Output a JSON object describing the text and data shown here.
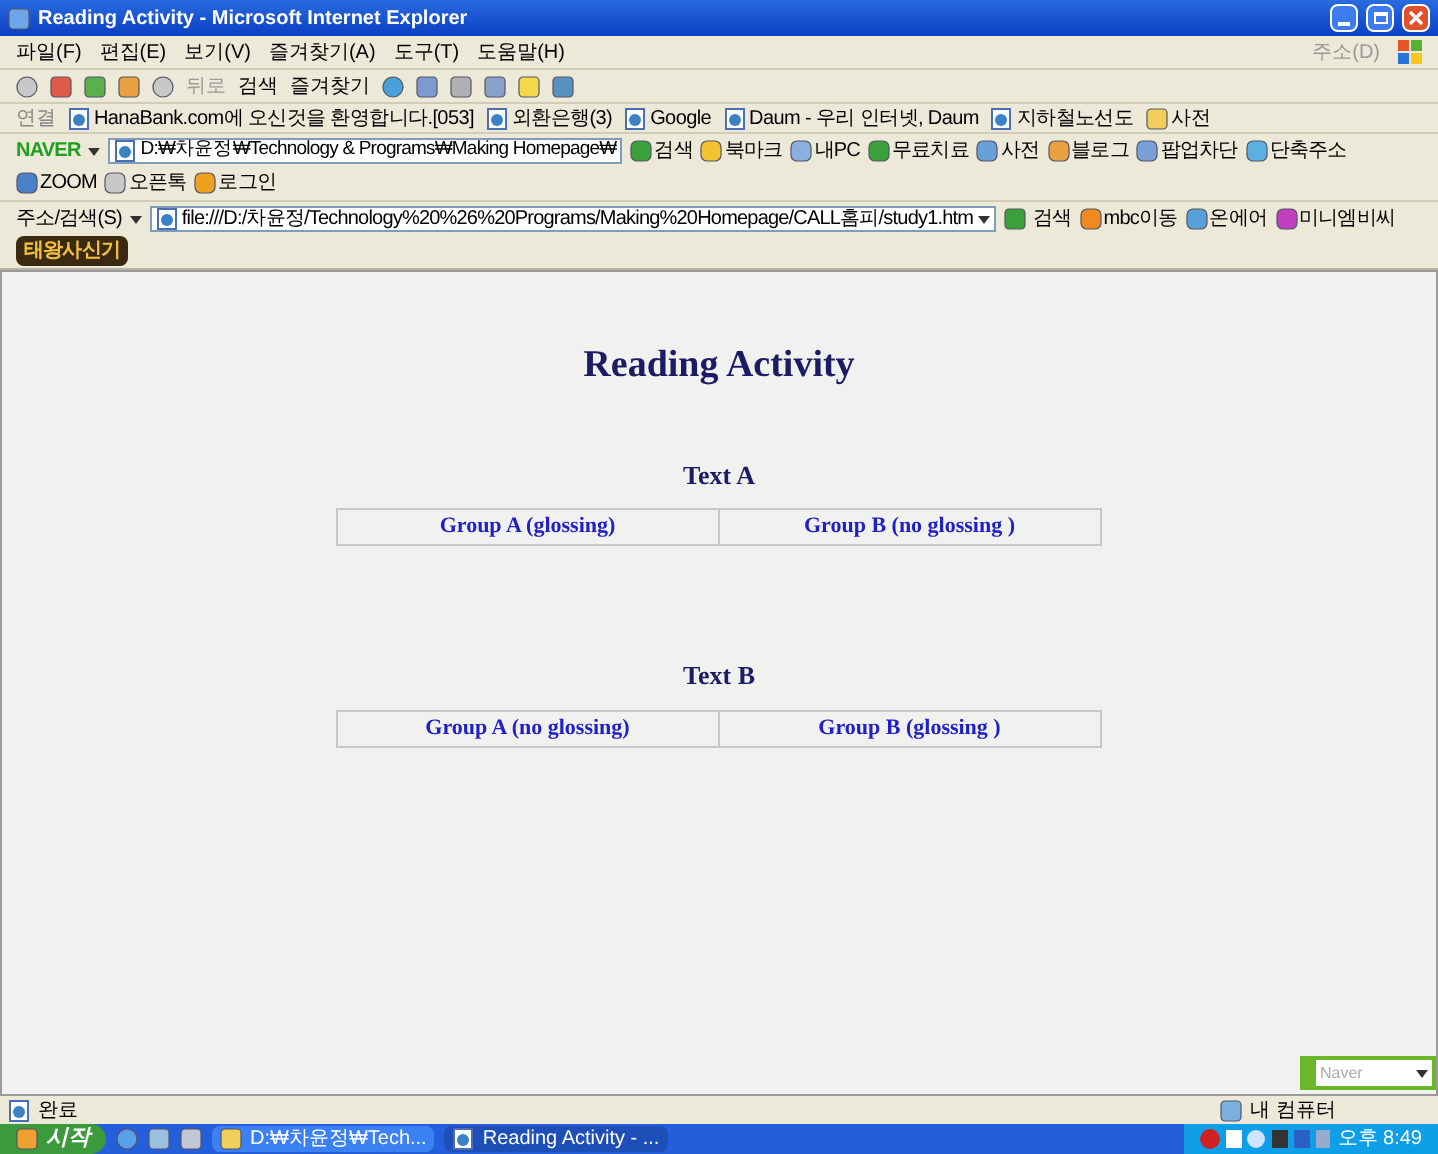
{
  "window": {
    "title": "Reading Activity - Microsoft Internet Explorer"
  },
  "menu_bar": {
    "items": [
      "파일(F)",
      "편집(E)",
      "보기(V)",
      "즐겨찾기(A)",
      "도구(T)",
      "도움말(H)"
    ],
    "address_label": "주소(D)"
  },
  "toolbar": {
    "buttons": [
      {
        "label": "뒤로",
        "disabled": true
      },
      {
        "label": "검색",
        "disabled": false
      },
      {
        "label": "즐겨찾기",
        "disabled": false
      }
    ]
  },
  "links_bar": {
    "label": "연결",
    "links": [
      "HanaBank.com에 오신것을 환영합니다.[053]",
      "외환은행(3)",
      "Google",
      "Daum - 우리 인터넷, Daum",
      "지하철노선도",
      "사전"
    ]
  },
  "naver_bar": {
    "logo": "NAVER",
    "path": "D:₩차윤정₩Technology & Programs₩Making Homepage₩",
    "items": [
      "검색",
      "북마크",
      "내PC",
      "무료치료",
      "사전",
      "블로그",
      "팝업차단",
      "단축주소",
      "ZOOM",
      "오픈톡",
      "로그인"
    ]
  },
  "address_bar": {
    "label": "주소/검색(S)",
    "url": "file:///D:/차윤정/Technology%20%26%20Programs/Making%20Homepage/CALL홈피/study1.htm",
    "search": "검색",
    "items": [
      "mbc이동",
      "온에어",
      "미니엠비씨"
    ],
    "banner": "태왕사신기"
  },
  "page": {
    "heading": "Reading Activity",
    "sections": [
      {
        "title": "Text A",
        "links": [
          "Group A (glossing)",
          "Group B (no glossing )"
        ]
      },
      {
        "title": "Text B",
        "links": [
          "Group A (no glossing)",
          "Group B (glossing )"
        ]
      }
    ]
  },
  "search_widget": {
    "placeholder": "Naver"
  },
  "status_bar": {
    "status": "완료",
    "zone": "내 컴퓨터"
  },
  "taskbar": {
    "start": "시작",
    "tasks": [
      {
        "label": "D:₩차윤정₩Tech...",
        "selected": false
      },
      {
        "label": "Reading Activity - ...",
        "selected": true
      }
    ],
    "clock": "오후 8:49"
  }
}
